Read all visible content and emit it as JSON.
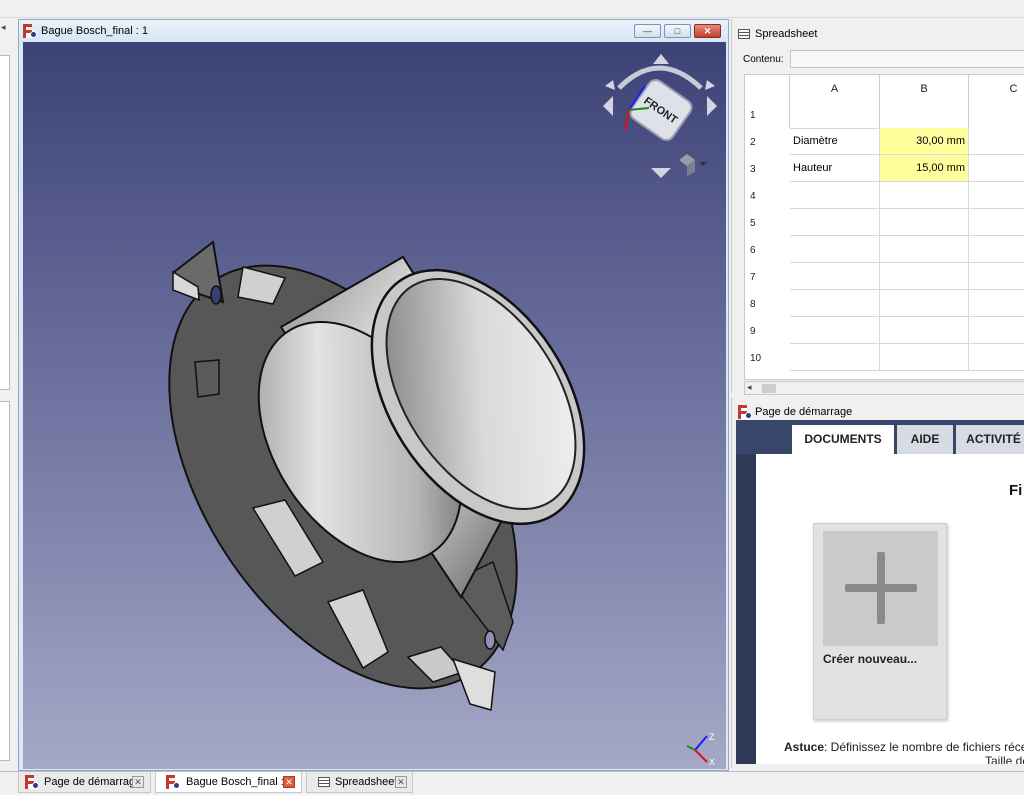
{
  "view_window": {
    "title": "Bague Bosch_final : 1",
    "buttons": {
      "minimize": "—",
      "restore": "□",
      "close": "✕"
    },
    "nav_cube_face": "FRONT",
    "axis": {
      "z": "Z",
      "x": "X"
    }
  },
  "spreadsheet": {
    "title": "Spreadsheet",
    "contents_label": "Contenu:",
    "contents_value": "",
    "columns": [
      "A",
      "B",
      "C"
    ],
    "rows": [
      {
        "num": "1",
        "a": "",
        "b": ""
      },
      {
        "num": "2",
        "a": "Diamètre",
        "b": "30,00 mm"
      },
      {
        "num": "3",
        "a": "Hauteur",
        "b": "15,00 mm"
      },
      {
        "num": "4",
        "a": "",
        "b": ""
      },
      {
        "num": "5",
        "a": "",
        "b": ""
      },
      {
        "num": "6",
        "a": "",
        "b": ""
      },
      {
        "num": "7",
        "a": "",
        "b": ""
      },
      {
        "num": "8",
        "a": "",
        "b": ""
      },
      {
        "num": "9",
        "a": "",
        "b": ""
      },
      {
        "num": "10",
        "a": "",
        "b": ""
      }
    ]
  },
  "start_page": {
    "title": "Page de démarrage",
    "tabs": [
      "DOCUMENTS",
      "AIDE",
      "ACTIVITÉ"
    ],
    "heading_partial": "Fi",
    "create_new": "Créer nouveau...",
    "tip_label": "Astuce",
    "tip_text": ": Définissez le nombre de fichiers récen",
    "tip_text2": "Taille de"
  },
  "bottom_tabs": [
    {
      "label": "Page de démarrage",
      "close": "✕"
    },
    {
      "label": "Bague Bosch_final : 1",
      "close": "✕"
    },
    {
      "label": "Spreadsheet",
      "close": "✕"
    }
  ],
  "colors": {
    "viewport_top": "#3c4275",
    "viewport_bottom": "#a5a8c6",
    "highlight_cell": "#ffff9e",
    "freecad_red": "#c0392b"
  }
}
